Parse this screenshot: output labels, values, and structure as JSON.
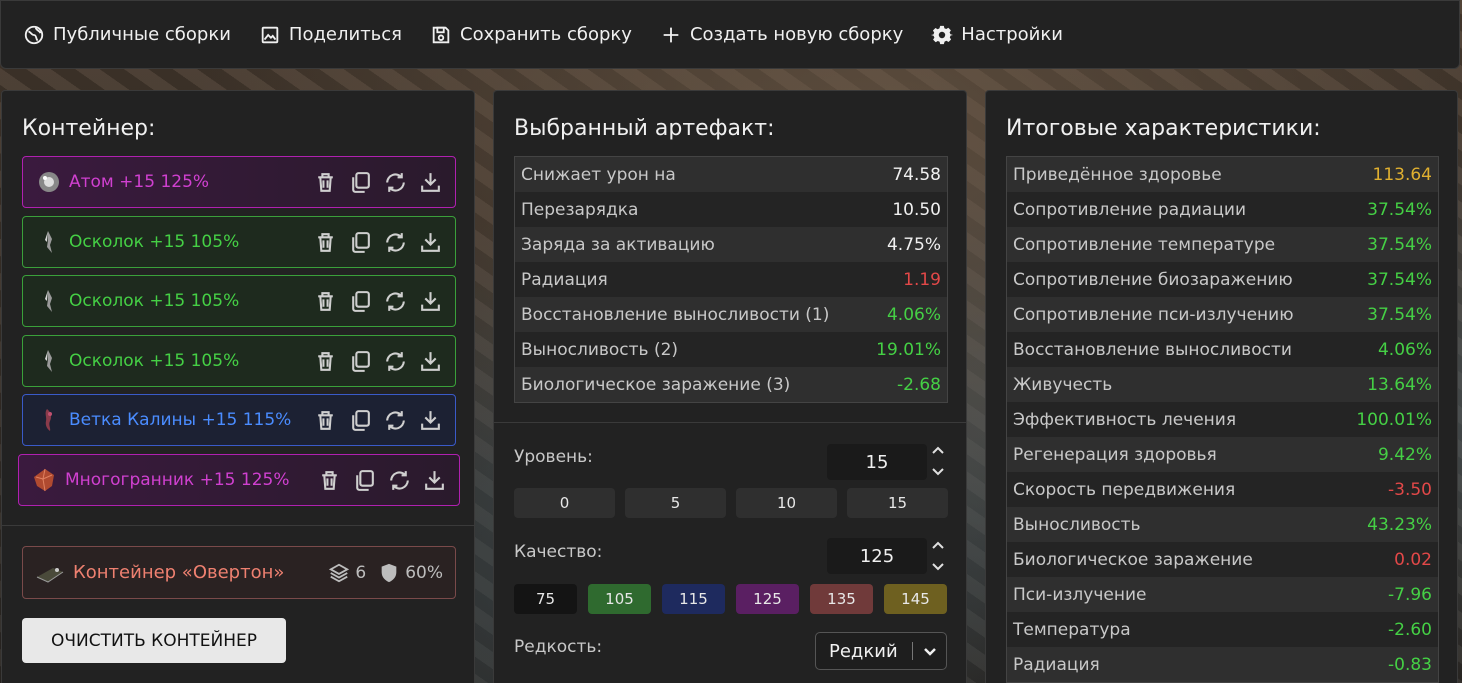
{
  "nav": {
    "public_builds": "Публичные сборки",
    "share": "Поделиться",
    "save_build": "Сохранить сборку",
    "new_build": "Создать новую сборку",
    "settings": "Настройки"
  },
  "container": {
    "title": "Контейнер:",
    "slots": [
      {
        "name": "Атом +15 125%",
        "color": "#d040d0"
      },
      {
        "name": "Осколок +15 105%",
        "color": "#45d045"
      },
      {
        "name": "Осколок +15 105%",
        "color": "#45d045"
      },
      {
        "name": "Осколок +15 105%",
        "color": "#45d045"
      },
      {
        "name": "Ветка Калины +15 115%",
        "color": "#4a8cff"
      },
      {
        "name": "Многогранник +15 125%",
        "color": "#d040d0"
      }
    ],
    "container_name": "Контейнер «Овертон»",
    "capacity": "6",
    "protection": "60%",
    "clear_button": "ОЧИСТИТЬ КОНТЕЙНЕР"
  },
  "artifact": {
    "title": "Выбранный артефакт:",
    "stats": [
      {
        "label": "Снижает урон на",
        "value": "74.58",
        "tone": "white"
      },
      {
        "label": "Перезарядка",
        "value": "10.50",
        "tone": "white"
      },
      {
        "label": "Заряда за активацию",
        "value": "4.75%",
        "tone": "white"
      },
      {
        "label": "Радиация",
        "value": "1.19",
        "tone": "red"
      },
      {
        "label": "Восстановление выносливости (1)",
        "value": "4.06%",
        "tone": "green"
      },
      {
        "label": "Выносливость (2)",
        "value": "19.01%",
        "tone": "green"
      },
      {
        "label": "Биологическое заражение (3)",
        "value": "-2.68",
        "tone": "green"
      }
    ],
    "level_label": "Уровень:",
    "level_value": "15",
    "level_presets": [
      "0",
      "5",
      "10",
      "15"
    ],
    "quality_label": "Качество:",
    "quality_value": "125",
    "quality_presets": [
      {
        "label": "75",
        "color": "#141414"
      },
      {
        "label": "105",
        "color": "#2f6a2f"
      },
      {
        "label": "115",
        "color": "#1e2a5e"
      },
      {
        "label": "125",
        "color": "#5a1f62"
      },
      {
        "label": "135",
        "color": "#703a3a"
      },
      {
        "label": "145",
        "color": "#6e6020"
      }
    ],
    "rarity_label": "Редкость:",
    "rarity_value": "Редкий"
  },
  "totals": {
    "title": "Итоговые характеристики:",
    "stats": [
      {
        "label": "Приведённое здоровье",
        "value": "113.64",
        "tone": "gold"
      },
      {
        "label": "Сопротивление радиации",
        "value": "37.54%",
        "tone": "green"
      },
      {
        "label": "Сопротивление температуре",
        "value": "37.54%",
        "tone": "green"
      },
      {
        "label": "Сопротивление биозаражению",
        "value": "37.54%",
        "tone": "green"
      },
      {
        "label": "Сопротивление пси-излучению",
        "value": "37.54%",
        "tone": "green"
      },
      {
        "label": "Восстановление выносливости",
        "value": "4.06%",
        "tone": "green"
      },
      {
        "label": "Живучесть",
        "value": "13.64%",
        "tone": "green"
      },
      {
        "label": "Эффективность лечения",
        "value": "100.01%",
        "tone": "green"
      },
      {
        "label": "Регенерация здоровья",
        "value": "9.42%",
        "tone": "green"
      },
      {
        "label": "Скорость передвижения",
        "value": "-3.50",
        "tone": "red"
      },
      {
        "label": "Выносливость",
        "value": "43.23%",
        "tone": "green"
      },
      {
        "label": "Биологическое заражение",
        "value": "0.02",
        "tone": "red"
      },
      {
        "label": "Пси-излучение",
        "value": "-7.96",
        "tone": "green"
      },
      {
        "label": "Температура",
        "value": "-2.60",
        "tone": "green"
      },
      {
        "label": "Радиация",
        "value": "-0.83",
        "tone": "green"
      }
    ]
  }
}
